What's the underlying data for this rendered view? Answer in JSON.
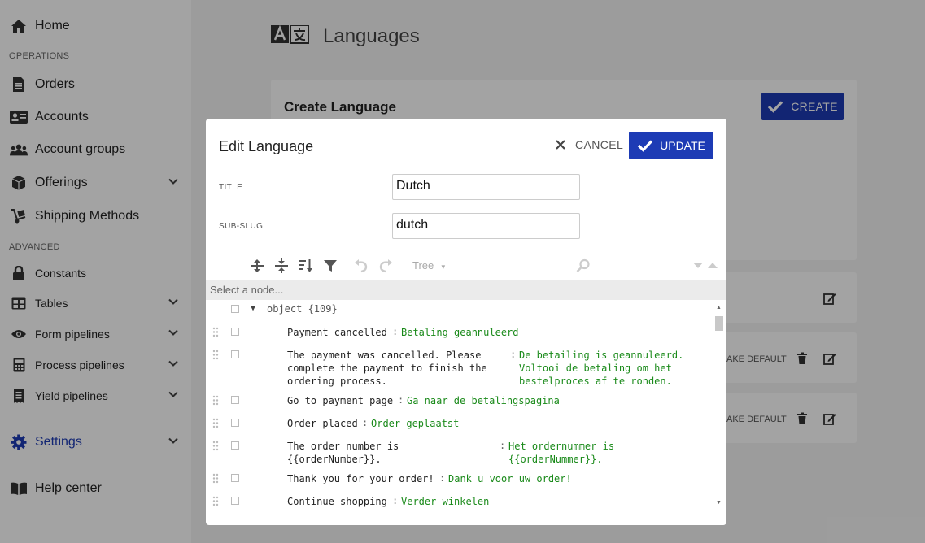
{
  "sidebar": {
    "home": "Home",
    "operations_hdr": "OPERATIONS",
    "orders": "Orders",
    "accounts": "Accounts",
    "account_groups": "Account groups",
    "offerings": "Offerings",
    "shipping": "Shipping Methods",
    "advanced_hdr": "ADVANCED",
    "constants": "Constants",
    "tables": "Tables",
    "form_pipelines": "Form pipelines",
    "process_pipelines": "Process pipelines",
    "yield_pipelines": "Yield pipelines",
    "settings": "Settings",
    "help": "Help center"
  },
  "page": {
    "title": "Languages",
    "create_card_title": "Create Language",
    "create_label": "CREATE",
    "make_default_label_1": "AKE DEFAULT",
    "make_default_label_2": "AKE DEFAULT"
  },
  "modal": {
    "title": "Edit Language",
    "cancel_label": "CANCEL",
    "update_label": "UPDATE",
    "title_field_label": "TITLE",
    "title_value": "Dutch",
    "subslug_label": "SUB-SLUG",
    "subslug_value": "dutch",
    "editor_mode": "Tree",
    "node_bar": "Select a node...",
    "root_node": "object {109}",
    "entries": [
      {
        "key": "Payment cancelled",
        "value": "Betaling geannuleerd"
      },
      {
        "key": "The payment was cancelled. Please\ncomplete the payment to finish the\nordering process.",
        "value": "De betailing is geannuleerd.\nVoltooi de betaling om het\nbestelproces af te ronden."
      },
      {
        "key": "Go to payment page",
        "value": "Ga naar de betalingspagina"
      },
      {
        "key": "Order placed",
        "value": "Order geplaatst"
      },
      {
        "key": "The order number is\n{{orderNumber}}.",
        "value": "Het ordernummer is\n{{orderNummer}}."
      },
      {
        "key": "Thank you for your order!",
        "value": "Dank u voor uw order!"
      },
      {
        "key": "Continue shopping",
        "value": "Verder winkelen"
      }
    ]
  },
  "colors": {
    "accent": "#1d3bb5",
    "json_value": "#1a8a1a"
  }
}
